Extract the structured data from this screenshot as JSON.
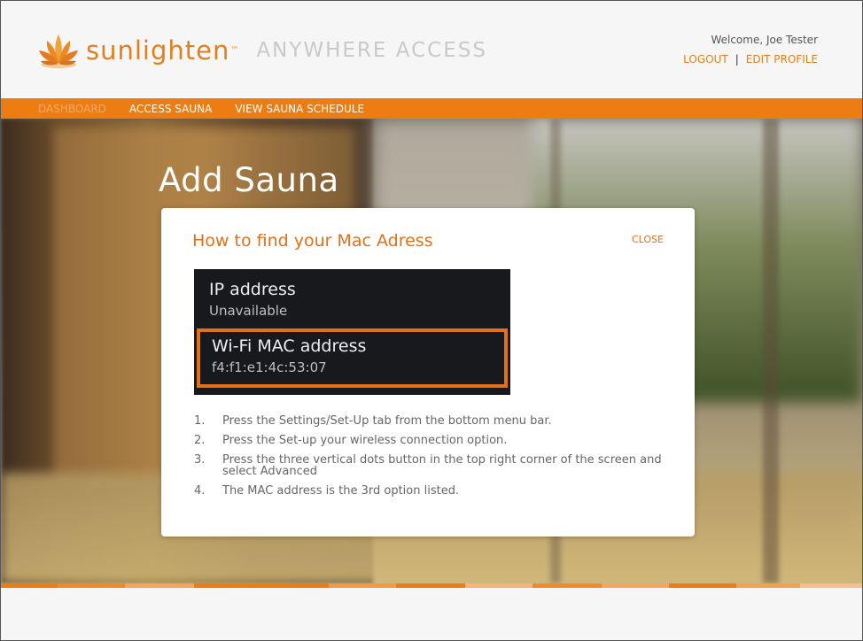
{
  "header": {
    "brand": "sunlighten",
    "brand_tm": "™",
    "subtitle": "ANYWHERE ACCESS",
    "welcome": "Welcome, Joe Tester",
    "logout": "LOGOUT",
    "separator": "|",
    "edit_profile": "EDIT PROFILE"
  },
  "nav": {
    "items": [
      {
        "label": "DASHBOARD",
        "active": true
      },
      {
        "label": "ACCESS SAUNA",
        "active": false
      },
      {
        "label": "VIEW SAUNA SCHEDULE",
        "active": false
      }
    ]
  },
  "page": {
    "title": "Add Sauna"
  },
  "modal": {
    "title": "How to find your Mac Adress",
    "close": "CLOSE",
    "device": {
      "ip_label": "IP address",
      "ip_value": "Unavailable",
      "mac_label": "Wi-Fi MAC address",
      "mac_value": "f4:f1:e1:4c:53:07"
    },
    "steps": [
      {
        "num": "1.",
        "text": "Press the Settings/Set-Up tab from the bottom menu bar."
      },
      {
        "num": "2.",
        "text": "Press the Set-up your wireless connection option."
      },
      {
        "num": "3.",
        "text": "Press the three vertical dots button in the top right corner of the screen and select Advanced"
      },
      {
        "num": "4.",
        "text": "The MAC address is the 3rd option listed."
      }
    ]
  },
  "colors": {
    "accent": "#ed7d13",
    "accent_text": "#e2701a",
    "nav_active": "#f7a862"
  },
  "icons": {
    "logo": "lotus-icon"
  }
}
